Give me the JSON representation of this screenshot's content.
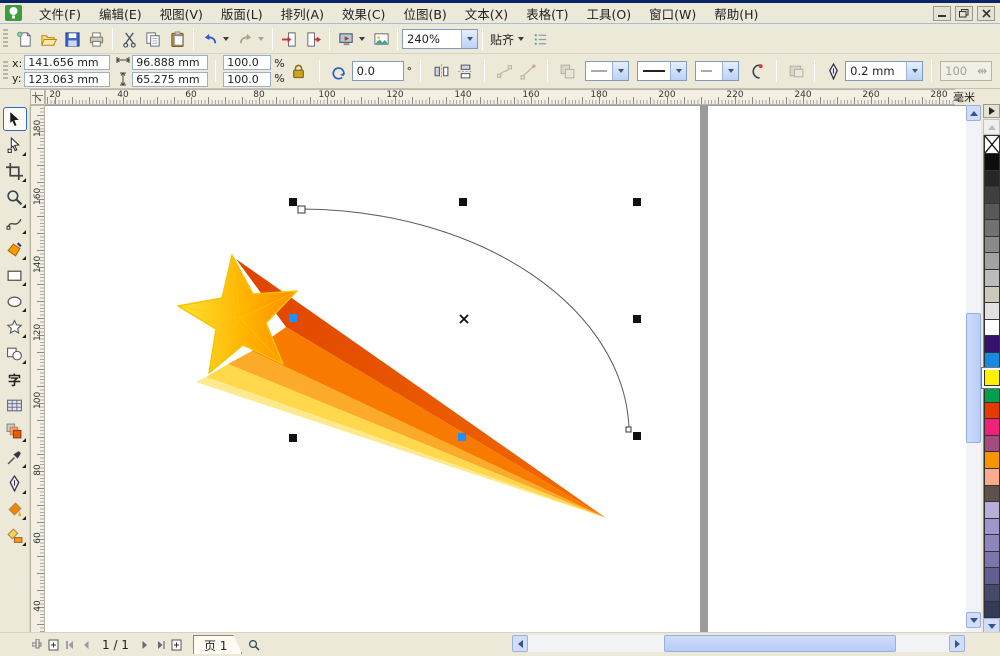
{
  "window": {
    "app": "CorelDRAW",
    "buttons": [
      "minimize",
      "restore",
      "close"
    ]
  },
  "menu": {
    "items": [
      {
        "id": "file",
        "label": "文件(F)"
      },
      {
        "id": "edit",
        "label": "编辑(E)"
      },
      {
        "id": "view",
        "label": "视图(V)"
      },
      {
        "id": "layout",
        "label": "版面(L)"
      },
      {
        "id": "arrange",
        "label": "排列(A)"
      },
      {
        "id": "effects",
        "label": "效果(C)"
      },
      {
        "id": "bitmaps",
        "label": "位图(B)"
      },
      {
        "id": "text",
        "label": "文本(X)"
      },
      {
        "id": "table",
        "label": "表格(T)"
      },
      {
        "id": "tools",
        "label": "工具(O)"
      },
      {
        "id": "window",
        "label": "窗口(W)"
      },
      {
        "id": "help",
        "label": "帮助(H)"
      }
    ]
  },
  "toolbar": {
    "zoom_value": "240%",
    "snap_label": "贴齐",
    "icons": [
      "new",
      "open",
      "save",
      "print",
      "cut",
      "copy",
      "paste",
      "undo",
      "redo",
      "import",
      "export",
      "application-launcher",
      "welcome-screen",
      "zoom-levels",
      "snap-to",
      "options"
    ]
  },
  "property_bar": {
    "x_label": "x:",
    "y_label": "y:",
    "x_value": "141.656 mm",
    "y_value": "123.063 mm",
    "width_value": "96.888 mm",
    "height_value": "65.275 mm",
    "scale_x": "100.0",
    "scale_y": "100.0",
    "percent": "%",
    "rotation_value": "0.0",
    "degree": "°",
    "outline_width": "0.2 mm",
    "wrap_value": "100"
  },
  "rulers": {
    "unit": "毫米",
    "top_labels": [
      20,
      40,
      60,
      80,
      100,
      120,
      140,
      160,
      180,
      200,
      220,
      240,
      260,
      280
    ],
    "left_labels": [
      180,
      160,
      140,
      120,
      100,
      80,
      60,
      40
    ]
  },
  "toolbox": {
    "text_glyph": "字",
    "tools": [
      {
        "id": "pick",
        "selected": true,
        "flyout": false
      },
      {
        "id": "shape",
        "selected": false,
        "flyout": true
      },
      {
        "id": "crop",
        "selected": false,
        "flyout": true
      },
      {
        "id": "zoom",
        "selected": false,
        "flyout": true
      },
      {
        "id": "freehand",
        "selected": false,
        "flyout": true
      },
      {
        "id": "smart-fill",
        "selected": false,
        "flyout": true
      },
      {
        "id": "rectangle",
        "selected": false,
        "flyout": true
      },
      {
        "id": "ellipse",
        "selected": false,
        "flyout": true
      },
      {
        "id": "polygon",
        "selected": false,
        "flyout": true
      },
      {
        "id": "basic-shapes",
        "selected": false,
        "flyout": true
      },
      {
        "id": "text",
        "selected": false,
        "flyout": false
      },
      {
        "id": "table",
        "selected": false,
        "flyout": false
      },
      {
        "id": "blend",
        "selected": false,
        "flyout": true
      },
      {
        "id": "eyedropper",
        "selected": false,
        "flyout": true
      },
      {
        "id": "outline-pen",
        "selected": false,
        "flyout": true
      },
      {
        "id": "fill",
        "selected": false,
        "flyout": true
      },
      {
        "id": "interactive-fill",
        "selected": false,
        "flyout": true
      }
    ]
  },
  "canvas": {
    "artwork": "orange shooting-star (comet) with gradient tail",
    "star_colors": [
      "#ffe235",
      "#ffb400",
      "#ff8a00"
    ],
    "tail_colors": [
      "#e64d00",
      "#f87b00",
      "#fcaa2a",
      "#ffd84d"
    ],
    "selection": {
      "handle_color": "#111111",
      "node_color": "#1e90ff",
      "curve_color": "#5a5a5a"
    }
  },
  "palette": {
    "selected": "yellow",
    "swatches": [
      {
        "name": "no-color",
        "color": "none"
      },
      {
        "name": "black",
        "color": "#0d0d0d"
      },
      {
        "name": "90-black",
        "color": "#262626"
      },
      {
        "name": "80-black",
        "color": "#3f3f3f"
      },
      {
        "name": "70-black",
        "color": "#585858"
      },
      {
        "name": "60-black",
        "color": "#717171"
      },
      {
        "name": "50-black",
        "color": "#8a8a8a"
      },
      {
        "name": "40-black",
        "color": "#a3a3a3"
      },
      {
        "name": "30-black",
        "color": "#bcbcbc"
      },
      {
        "name": "20-black",
        "color": "#cdc9ba"
      },
      {
        "name": "10-black",
        "color": "#e2e2e2"
      },
      {
        "name": "white",
        "color": "#ffffff"
      },
      {
        "name": "violet",
        "color": "#35126d"
      },
      {
        "name": "blue",
        "color": "#1789e0"
      },
      {
        "name": "yellow",
        "color": "#ffef00",
        "selected": true
      },
      {
        "name": "green",
        "color": "#00a04e"
      },
      {
        "name": "red",
        "color": "#e63b00"
      },
      {
        "name": "magenta",
        "color": "#ee2277"
      },
      {
        "name": "purple",
        "color": "#a34a7e"
      },
      {
        "name": "orange",
        "color": "#f79500"
      },
      {
        "name": "pink",
        "color": "#fba98c"
      },
      {
        "name": "dark-brown",
        "color": "#5c5249"
      },
      {
        "name": "pale-lavender",
        "color": "#b7aed9"
      },
      {
        "name": "lavender",
        "color": "#9e96cb"
      },
      {
        "name": "light-slate",
        "color": "#8d86bd"
      },
      {
        "name": "slate",
        "color": "#7c76ae"
      },
      {
        "name": "dark-slate",
        "color": "#635f93"
      },
      {
        "name": "navy",
        "color": "#45496e"
      },
      {
        "name": "dark-navy",
        "color": "#343b58"
      }
    ]
  },
  "statusbar": {
    "page_indicator": "1 / 1",
    "page_tab_label": "页 1"
  }
}
